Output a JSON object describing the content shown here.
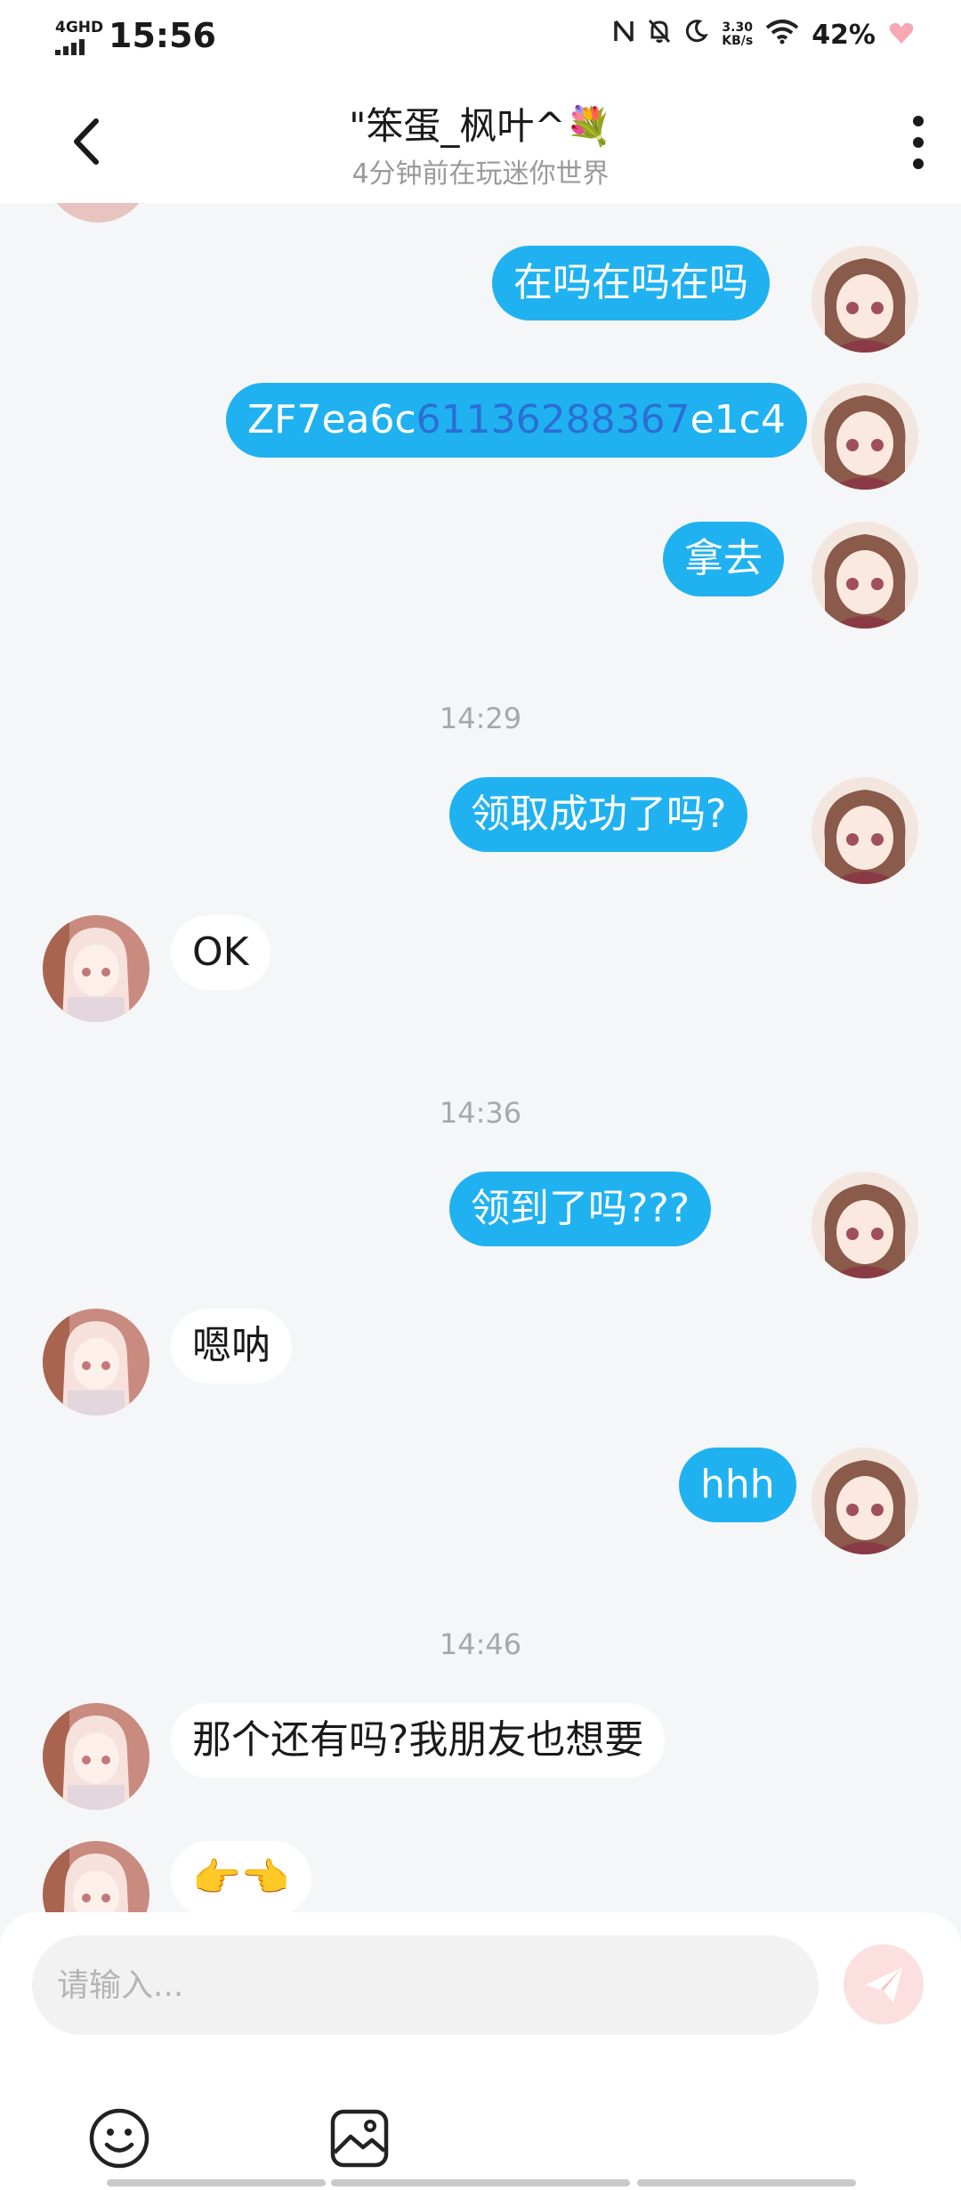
{
  "status_bar": {
    "network": "4GHD",
    "time": "15:56",
    "speed_value": "3.30",
    "speed_unit": "KB/s",
    "battery": "42%",
    "icons": [
      "nfc-icon",
      "mute-icon",
      "moon-icon",
      "wifi-icon",
      "heart-battery-icon"
    ]
  },
  "header": {
    "title": "\"笨蛋_枫叶^💐",
    "subtitle": "4分钟前在玩迷你世界",
    "back_icon": "chevron-left-icon",
    "more_icon": "more-vertical-icon"
  },
  "messages": [
    {
      "id": "m1",
      "from": "me",
      "text": "在吗在吗在吗"
    },
    {
      "id": "m2",
      "from": "me",
      "text_parts": [
        "ZF7ea6c",
        "61136288367",
        "e1c4"
      ]
    },
    {
      "id": "m3",
      "from": "me",
      "text": "拿去"
    },
    {
      "id": "t1",
      "type": "time",
      "text": "14:29"
    },
    {
      "id": "m4",
      "from": "me",
      "text": "领取成功了吗?"
    },
    {
      "id": "m5",
      "from": "friend",
      "text": "OK"
    },
    {
      "id": "t2",
      "type": "time",
      "text": "14:36"
    },
    {
      "id": "m6",
      "from": "me",
      "text": "领到了吗???"
    },
    {
      "id": "m7",
      "from": "friend",
      "text": "嗯呐"
    },
    {
      "id": "m8",
      "from": "me",
      "text": "hhh"
    },
    {
      "id": "t3",
      "type": "time",
      "text": "14:46"
    },
    {
      "id": "m9",
      "from": "friend",
      "text": "那个还有吗?我朋友也想要"
    },
    {
      "id": "m10",
      "from": "friend",
      "text": "👉👈"
    }
  ],
  "composer": {
    "placeholder": "请输入...",
    "send_icon": "paper-plane-icon",
    "tools": [
      "emoji-icon",
      "image-icon"
    ]
  },
  "colors": {
    "sent_bubble": "#20b2f0",
    "received_bubble": "#ffffff",
    "background": "#f5f6f8",
    "send_button": "#fbe0df",
    "highlight": "#2a6fd6"
  }
}
